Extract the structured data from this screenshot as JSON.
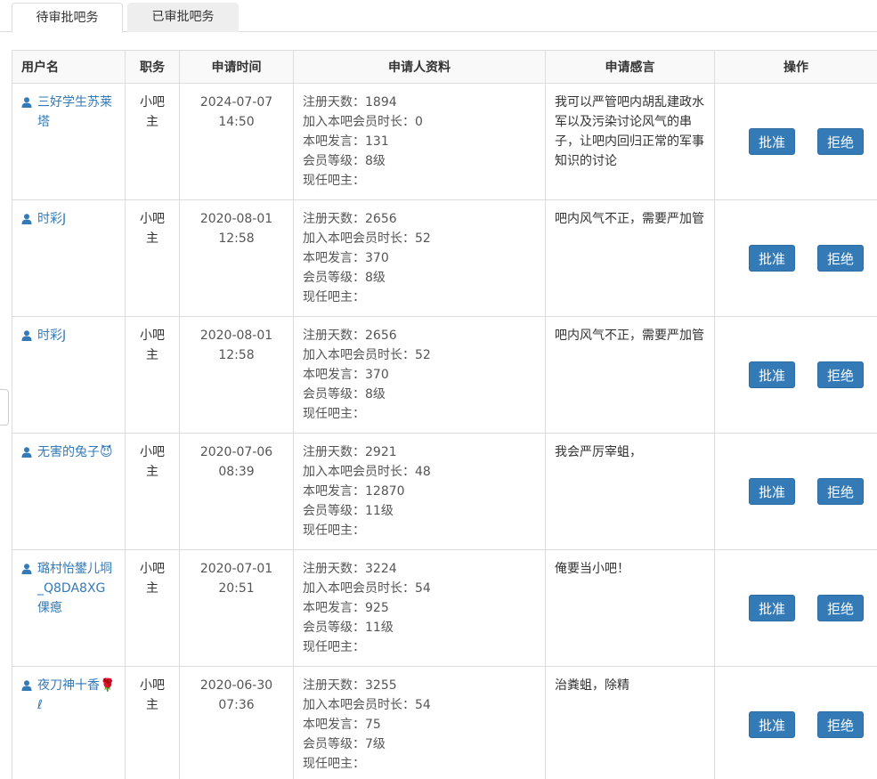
{
  "tabs": [
    {
      "label": "待审批吧务"
    },
    {
      "label": "已审批吧务"
    }
  ],
  "table": {
    "headers": {
      "user": "用户名",
      "role": "职务",
      "time": "申请时间",
      "info": "申请人资料",
      "reason": "申请感言",
      "ops": "操作"
    },
    "rows": [
      {
        "username": "三好学生苏莱塔",
        "role": "小吧主",
        "date": "2024-07-07",
        "time": "14:50",
        "info": [
          "注册天数：1894",
          "加入本吧会员时长：0",
          "本吧发言：131",
          "会员等级：8级",
          "现任吧主："
        ],
        "reason": "我可以严管吧内胡乱建政水军以及污染讨论风气的串子，让吧内回归正常的军事知识的讨论",
        "approve": "批准",
        "reject": "拒绝"
      },
      {
        "username": "时彩J",
        "role": "小吧主",
        "date": "2020-08-01",
        "time": "12:58",
        "info": [
          "注册天数：2656",
          "加入本吧会员时长：52",
          "本吧发言：370",
          "会员等级：8级",
          "现任吧主："
        ],
        "reason": "吧内风气不正，需要严加管",
        "approve": "批准",
        "reject": "拒绝"
      },
      {
        "username": "时彩J",
        "role": "小吧主",
        "date": "2020-08-01",
        "time": "12:58",
        "info": [
          "注册天数：2656",
          "加入本吧会员时长：52",
          "本吧发言：370",
          "会员等级：8级",
          "现任吧主："
        ],
        "reason": "吧内风气不正，需要严加管",
        "approve": "批准",
        "reject": "拒绝"
      },
      {
        "username": "无害的兔子😈",
        "role": "小吧主",
        "date": "2020-07-06",
        "time": "08:39",
        "info": [
          "注册天数：2921",
          "加入本吧会员时长：48",
          "本吧发言：12870",
          "会员等级：11级",
          "现任吧主："
        ],
        "reason": "我会严厉宰蛆，",
        "approve": "批准",
        "reject": "拒绝"
      },
      {
        "username": "璐村怡鐢儿垌_Q8DA8XG倮瘜",
        "role": "小吧主",
        "date": "2020-07-01",
        "time": "20:51",
        "info": [
          "注册天数：3224",
          "加入本吧会员时长：54",
          "本吧发言：925",
          "会员等级：11级",
          "现任吧主："
        ],
        "reason": "俺要当小吧！",
        "approve": "批准",
        "reject": "拒绝"
      },
      {
        "username": "夜刀神十香🌹ℓ",
        "role": "小吧主",
        "date": "2020-06-30",
        "time": "07:36",
        "info": [
          "注册天数：3255",
          "加入本吧会员时长：54",
          "本吧发言：75",
          "会员等级：7级",
          "现任吧主："
        ],
        "reason": "治粪蛆，除精",
        "approve": "批准",
        "reject": "拒绝"
      }
    ]
  }
}
